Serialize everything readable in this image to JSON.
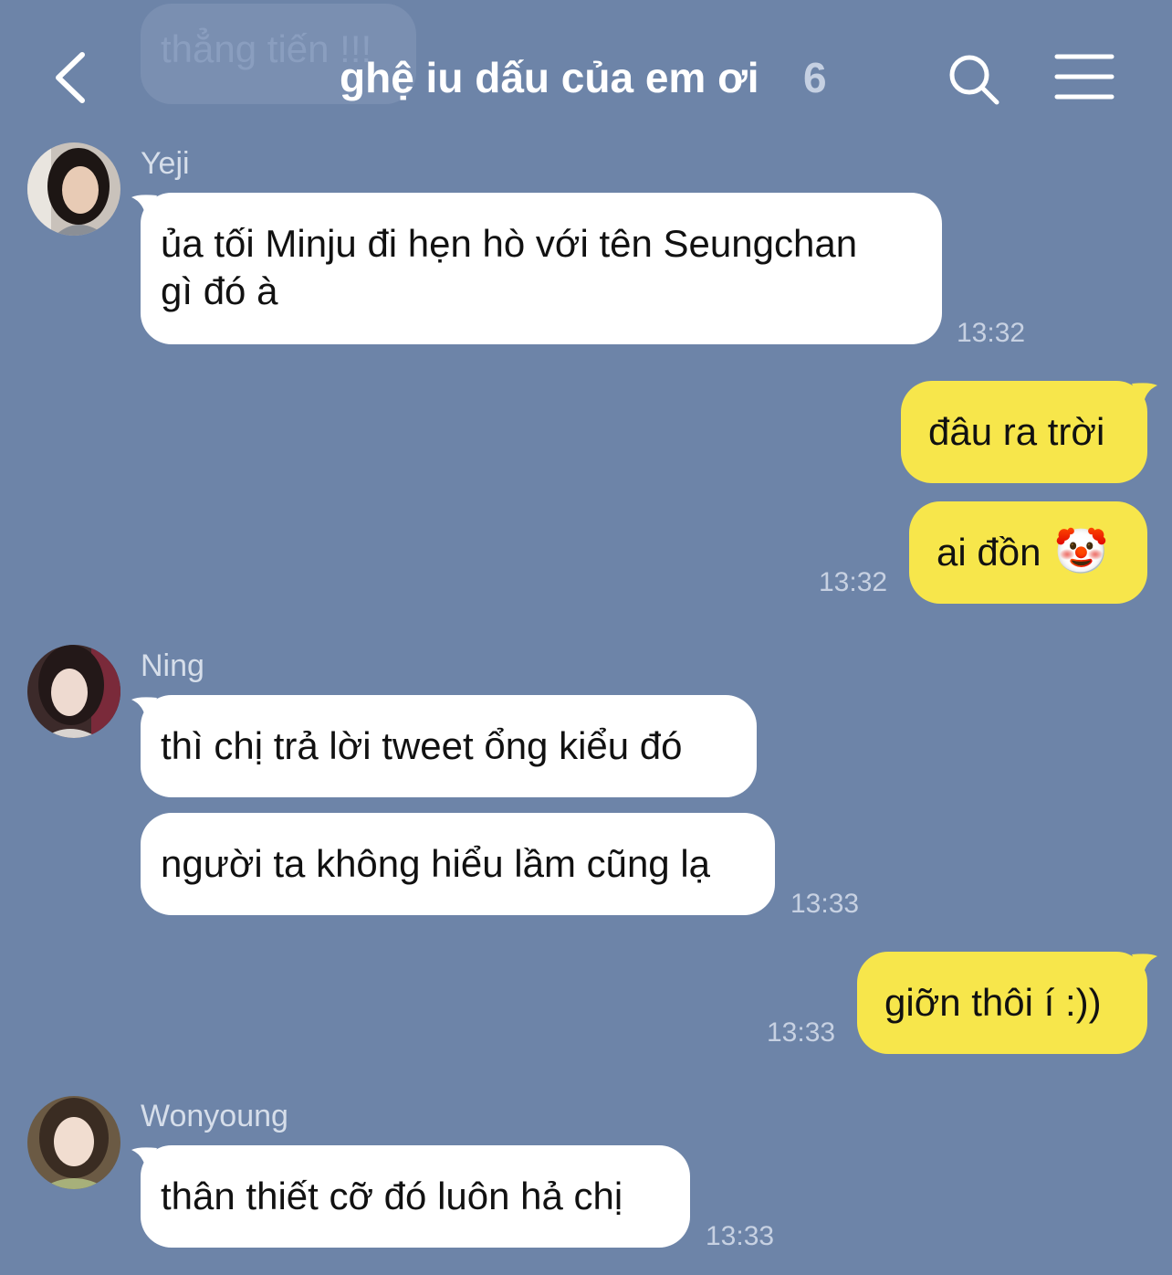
{
  "header": {
    "title": "ghệ iu dấu của em ơi",
    "member_count": "6",
    "pinned_text": "thẳng tiến !!!"
  },
  "messages": [
    {
      "sender": "Yeji",
      "lines": [
        "ủa tối Minju đi hẹn hò với tên Seungchan",
        "gì đó à"
      ],
      "time": "13:32"
    },
    {
      "text": "đâu ra trời"
    },
    {
      "text": "ai đồn",
      "emoji": "🤡",
      "time": "13:32"
    },
    {
      "sender": "Ning",
      "text": "thì chị trả lời tweet ổng kiểu đó"
    },
    {
      "text": "người ta không hiểu lầm cũng lạ",
      "time": "13:33"
    },
    {
      "text": "giỡn thôi í :))",
      "time": "13:33"
    },
    {
      "sender": "Wonyoung",
      "text": "thân thiết cỡ đó luôn hả chị",
      "time": "13:33"
    }
  ],
  "icons": {
    "back": "chevron-left-icon",
    "search": "search-icon",
    "menu": "hamburger-menu-icon"
  },
  "colors": {
    "background": "#6d84a8",
    "incoming_bubble": "#ffffff",
    "outgoing_bubble": "#f7e64b"
  }
}
